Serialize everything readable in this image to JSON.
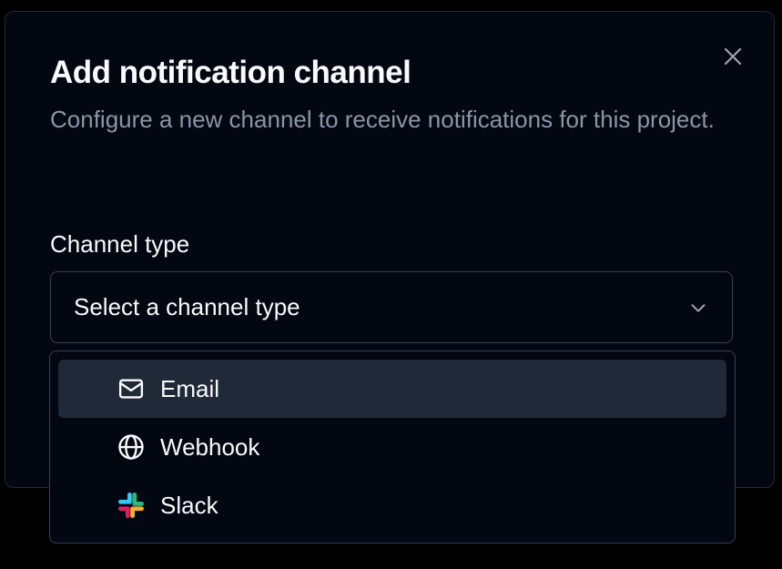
{
  "dialog": {
    "title": "Add notification channel",
    "description": "Configure a new channel to receive notifications for this project.",
    "close_icon": "close-icon"
  },
  "field": {
    "label": "Channel type",
    "placeholder": "Select a channel type",
    "chevron_icon": "chevron-down-icon"
  },
  "options": [
    {
      "label": "Email",
      "icon": "mail-icon",
      "highlighted": true
    },
    {
      "label": "Webhook",
      "icon": "globe-icon",
      "highlighted": false
    },
    {
      "label": "Slack",
      "icon": "slack-icon",
      "highlighted": false
    }
  ],
  "colors": {
    "background": "#000000",
    "surface": "#030712",
    "border": "#374151",
    "highlight": "#1f2937",
    "text": "#f9fafb",
    "muted_text": "#8b95a5"
  }
}
